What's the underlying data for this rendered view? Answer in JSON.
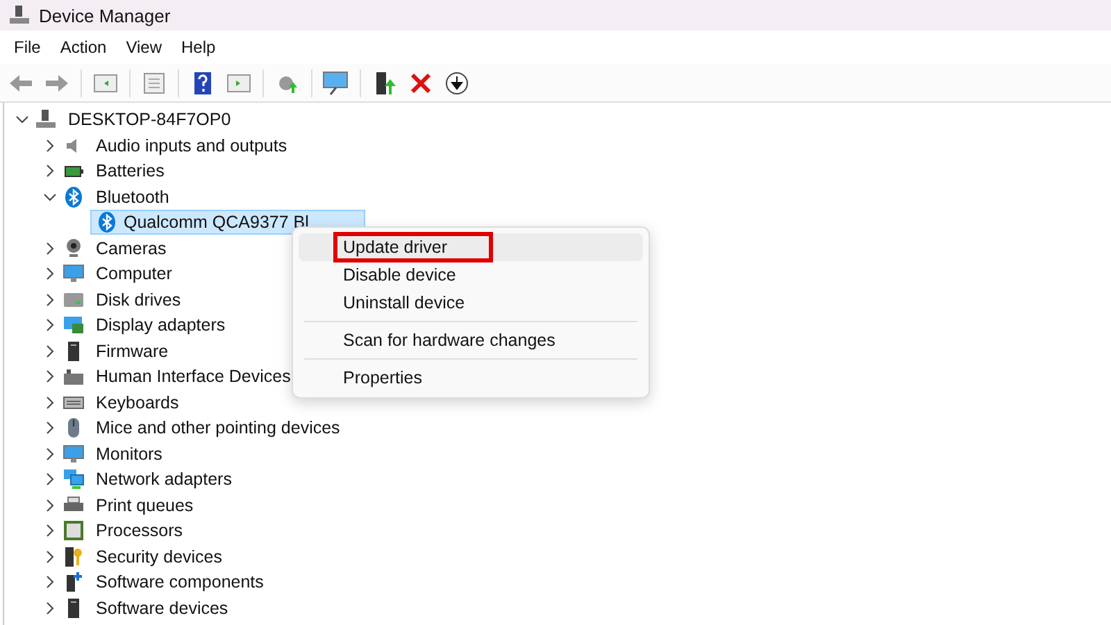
{
  "window": {
    "title": "Device Manager"
  },
  "menu": [
    {
      "label": "File"
    },
    {
      "label": "Action"
    },
    {
      "label": "View"
    },
    {
      "label": "Help"
    }
  ],
  "tree": {
    "label": "DESKTOP-84F7OP0",
    "expanded": true,
    "children": [
      {
        "label": "Audio inputs and outputs",
        "kind": "audio",
        "expanded": false,
        "selected": false
      },
      {
        "label": "Batteries",
        "kind": "battery",
        "expanded": false,
        "selected": false
      },
      {
        "label": "Bluetooth",
        "kind": "bluetooth",
        "expanded": true,
        "selected": false,
        "children": [
          {
            "label": "Qualcomm QCA9377 Bl",
            "kind": "bluetooth",
            "selected": true
          }
        ]
      },
      {
        "label": "Cameras",
        "kind": "camera",
        "expanded": false,
        "selected": false
      },
      {
        "label": "Computer",
        "kind": "monitor",
        "expanded": false,
        "selected": false
      },
      {
        "label": "Disk drives",
        "kind": "drive",
        "expanded": false,
        "selected": false
      },
      {
        "label": "Display adapters",
        "kind": "display",
        "expanded": false,
        "selected": false
      },
      {
        "label": "Firmware",
        "kind": "firmware",
        "expanded": false,
        "selected": false
      },
      {
        "label": "Human Interface Devices",
        "kind": "hid",
        "expanded": false,
        "selected": false
      },
      {
        "label": "Keyboards",
        "kind": "keyboard",
        "expanded": false,
        "selected": false
      },
      {
        "label": "Mice and other pointing devices",
        "kind": "mouse",
        "expanded": false,
        "selected": false
      },
      {
        "label": "Monitors",
        "kind": "monitor",
        "expanded": false,
        "selected": false
      },
      {
        "label": "Network adapters",
        "kind": "network",
        "expanded": false,
        "selected": false
      },
      {
        "label": "Print queues",
        "kind": "printer",
        "expanded": false,
        "selected": false
      },
      {
        "label": "Processors",
        "kind": "chip",
        "expanded": false,
        "selected": false
      },
      {
        "label": "Security devices",
        "kind": "security",
        "expanded": false,
        "selected": false
      },
      {
        "label": "Software components",
        "kind": "software",
        "expanded": false,
        "selected": false
      },
      {
        "label": "Software devices",
        "kind": "firmware",
        "expanded": false,
        "selected": false
      }
    ]
  },
  "context_menu": [
    {
      "label": "Update driver",
      "kind": "item",
      "selected": true,
      "outlined": true
    },
    {
      "label": "Disable device",
      "kind": "item",
      "selected": false,
      "outlined": false
    },
    {
      "label": "Uninstall device",
      "kind": "item",
      "selected": false,
      "outlined": false
    },
    {
      "kind": "separator"
    },
    {
      "label": "Scan for hardware changes",
      "kind": "item",
      "selected": false,
      "outlined": false
    },
    {
      "kind": "separator"
    },
    {
      "label": "Properties",
      "kind": "item",
      "selected": false,
      "outlined": false
    }
  ]
}
